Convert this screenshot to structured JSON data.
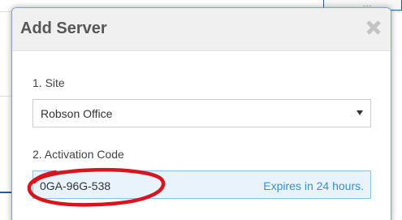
{
  "dialog": {
    "title": "Add Server",
    "close_icon": "close-icon"
  },
  "form": {
    "site": {
      "label": "1. Site",
      "selected": "Robson Office"
    },
    "activation": {
      "label": "2. Activation Code",
      "code": "0GA-96G-538",
      "expiry_text": "Expires in 24 hours."
    }
  },
  "colors": {
    "dialog_border": "#8aa2bf",
    "header_bg": "#f0f0f0",
    "code_box_bg": "#e8f3fb",
    "code_box_border": "#8ec1e2",
    "expiry_text": "#3a8fd0",
    "annotation": "#d9141d"
  }
}
